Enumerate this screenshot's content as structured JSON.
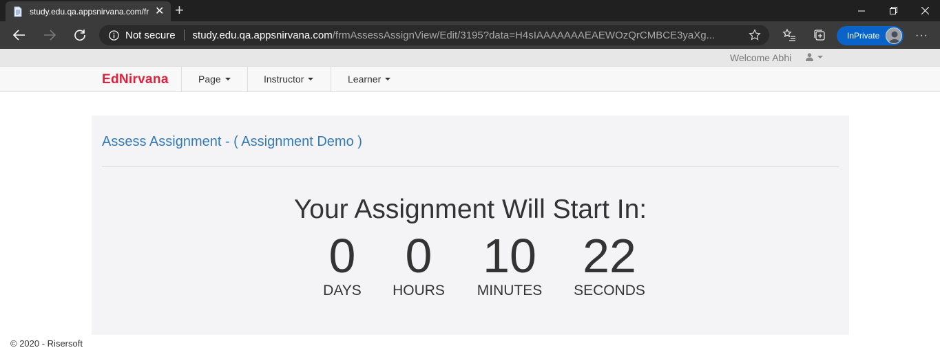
{
  "browser": {
    "tab_title": "study.edu.qa.appsnirvana.com/fr",
    "security_label": "Not secure",
    "url_host": "study.edu.qa.appsnirvana.com",
    "url_path": "/frmAssessAssignView/Edit/3195?data=H4sIAAAAAAAEAEWOzQrCMBCE3yaXg...",
    "inprivate_label": "InPrivate",
    "more_label": "···"
  },
  "header": {
    "welcome_text": "Welcome Abhi"
  },
  "navbar": {
    "brand": "EdNirvana",
    "items": [
      {
        "label": "Page"
      },
      {
        "label": "Instructor"
      },
      {
        "label": "Learner"
      }
    ]
  },
  "main": {
    "title": "Assess Assignment - ( Assignment Demo )",
    "countdown_heading": "Your Assignment Will Start In:",
    "countdown": [
      {
        "value": "0",
        "label": "DAYS"
      },
      {
        "value": "0",
        "label": "HOURS"
      },
      {
        "value": "10",
        "label": "MINUTES"
      },
      {
        "value": "22",
        "label": "SECONDS"
      }
    ]
  },
  "footer": {
    "copyright": "© 2020 - Risersoft"
  },
  "colors": {
    "brand": "#e0203a",
    "link": "#337ab7",
    "inprivate_badge": "#0a63c8"
  }
}
